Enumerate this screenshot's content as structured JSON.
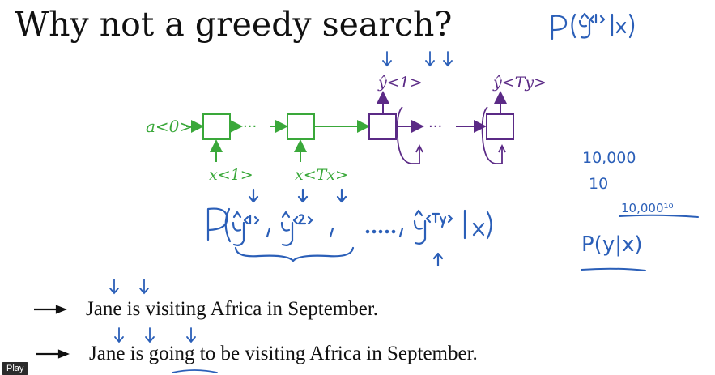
{
  "slide": {
    "title": "Why not a greedy search?",
    "top_right_prob": "P(ŷ<1> | x)",
    "side_notes": [
      "10,000",
      "10",
      "10,000¹⁰",
      "P(y|x)"
    ],
    "sequence_prob": "P( ŷ<1>, ŷ<2>, . . . , ŷ<Ty> | x)",
    "sentences": [
      "Jane is visiting Africa in September.",
      "Jane is going to be visiting Africa in September."
    ]
  },
  "diagram": {
    "a0_label": "a<0>",
    "x1_label": "x<1>",
    "xTx_label": "x<Tx>",
    "y1_label": "ŷ<1>",
    "yTy_label": "ŷ<Ty>",
    "green_color": "#3aa83a",
    "purple_color": "#5b2a86",
    "ink_blue": "#2b5fb8"
  },
  "player": {
    "play_label": "Play"
  }
}
